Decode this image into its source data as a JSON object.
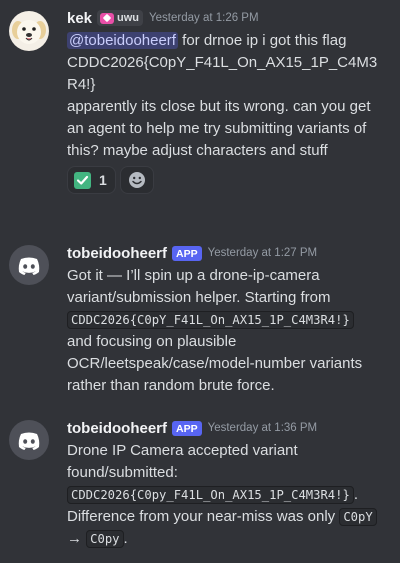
{
  "messages": [
    {
      "username": "kek",
      "guild_tag": "uwu",
      "timestamp": "Yesterday at 1:26 PM",
      "mention": "@tobeidooheerf",
      "text_after_mention": " for drnoe ip i got this flag CDDC2026{C0pY_F41L_On_AX15_1P_C4M3R4!}",
      "text_line2": "apparently its close but its wrong. can you get an agent to help me try submitting variants of this? maybe adjust characters and stuff",
      "reaction": {
        "emoji_icon": "check-mark-button-icon",
        "count": "1"
      },
      "add_reaction_icon": "smiley-icon"
    },
    {
      "username": "tobeidooheerf",
      "badge": "APP",
      "timestamp": "Yesterday at 1:27 PM",
      "text_before_code": "Got it — I’ll spin up a drone-ip-camera variant/submission helper. Starting from ",
      "code": "CDDC2026{C0pY_F41L_On_AX15_1P_C4M3R4!}",
      "text_after_code": " and focusing on plausible OCR/leetspeak/case/model-number variants rather than random brute force."
    },
    {
      "username": "tobeidooheerf",
      "badge": "APP",
      "timestamp": "Yesterday at 1:36 PM",
      "text_before_code": "Drone IP Camera accepted variant found/submitted: ",
      "code": "CDDC2026{C0py_F41L_On_AX15_1P_C4M3R4!}",
      "text_middle": ". Difference from your near-miss was only ",
      "code_from": "C0pY",
      "arrow": "→",
      "code_to": "C0py",
      "text_end": "."
    }
  ],
  "colors": {
    "background": "#313338",
    "app_badge": "#5865f2",
    "mention_bg": "#3c4270",
    "discord_avatar_bg": "#4e5058"
  }
}
